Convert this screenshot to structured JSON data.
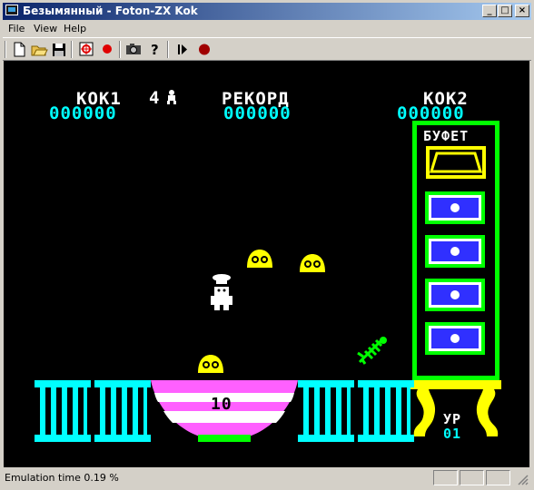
{
  "window": {
    "title": "Безымянный - Foton-ZX Kok",
    "controls": {
      "minimize": "_",
      "maximize": "□",
      "close": "×"
    }
  },
  "menu": {
    "file": "File",
    "view": "View",
    "help": "Help"
  },
  "toolbar": {
    "icons": [
      "new-file-icon",
      "open-folder-icon",
      "save-disk-icon",
      "target-icon",
      "record-icon",
      "camera-icon",
      "help-question-icon",
      "play-icon",
      "stop-record-icon"
    ]
  },
  "game": {
    "player1_label": "КОК1",
    "player1_score": "000000",
    "lives": "4",
    "record_label": "РЕКОРД",
    "record_score": "000000",
    "player2_label": "КОК2",
    "player2_score": "000000",
    "buffet_label": "БУФЕТ",
    "bowl_counter": "10",
    "level_label": "УР",
    "level_value": "01",
    "colors": {
      "cyan": "#00ffff",
      "white": "#ffffff",
      "yellow": "#ffff00",
      "green": "#00ff00",
      "blue": "#3030ff",
      "magenta": "#ff60ff",
      "black": "#000000"
    }
  },
  "status": {
    "emulation_time": "Emulation time  0.19 %"
  }
}
